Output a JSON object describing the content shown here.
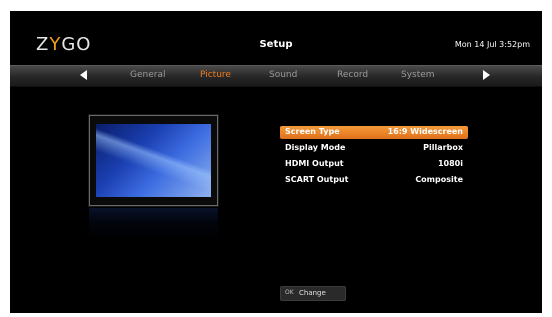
{
  "header": {
    "logo": {
      "pre": "Z",
      "mid": "Y",
      "post": "GO"
    },
    "title": "Setup",
    "clock": "Mon 14 Jul 3:52pm"
  },
  "tabs": [
    {
      "label": "General",
      "active": false
    },
    {
      "label": "Picture",
      "active": true
    },
    {
      "label": "Sound",
      "active": false
    },
    {
      "label": "Record",
      "active": false
    },
    {
      "label": "System",
      "active": false
    }
  ],
  "settings": [
    {
      "label": "Screen Type",
      "value": "16:9 Widescreen",
      "selected": true
    },
    {
      "label": "Display Mode",
      "value": "Pillarbox",
      "selected": false
    },
    {
      "label": "HDMI Output",
      "value": "1080i",
      "selected": false
    },
    {
      "label": "SCART Output",
      "value": "Composite",
      "selected": false
    }
  ],
  "footer": {
    "button": "OK",
    "label": "Change"
  },
  "colors": {
    "accent": "#f07a18",
    "selected_row": "#f0861f",
    "background": "#000000"
  }
}
